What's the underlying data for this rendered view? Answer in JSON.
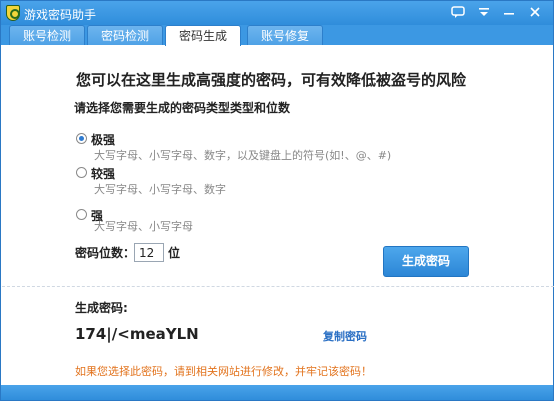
{
  "window": {
    "title": "游戏密码助手"
  },
  "titlebar": {
    "icons": [
      "shield-key-icon",
      "feedback-icon",
      "menu-icon",
      "minimize-icon",
      "close-icon"
    ]
  },
  "tabs": [
    {
      "label": "账号检测",
      "active": false
    },
    {
      "label": "密码检测",
      "active": false
    },
    {
      "label": "密码生成",
      "active": true
    },
    {
      "label": "账号修复",
      "active": false
    }
  ],
  "main": {
    "headline": "您可以在这里生成高强度的密码，可有效降低被盗号的风险",
    "subhead": "请选择您需要生成的密码类型类型和位数",
    "options": [
      {
        "label": "极强",
        "desc": "大写字母、小写字母、数字，以及键盘上的符号(如!、@、#)",
        "checked": true
      },
      {
        "label": "较强",
        "desc": "大写字母、小写字母、数字",
        "checked": false
      },
      {
        "label": "强",
        "desc": "大写字母、小写字母",
        "checked": false
      }
    ],
    "length_label": "密码位数：",
    "length_value": "12",
    "length_unit": "位",
    "generate_button": "生成密码"
  },
  "result": {
    "label": "生成密码:",
    "value": "174|/<meaYLN",
    "copy_link": "复制密码",
    "warning": "如果您选择此密码，请到相关网站进行修改，并牢记该密码！"
  },
  "colors": {
    "accent": "#2f8ddb",
    "link": "#2a6fc4",
    "warning": "#e2731d"
  }
}
